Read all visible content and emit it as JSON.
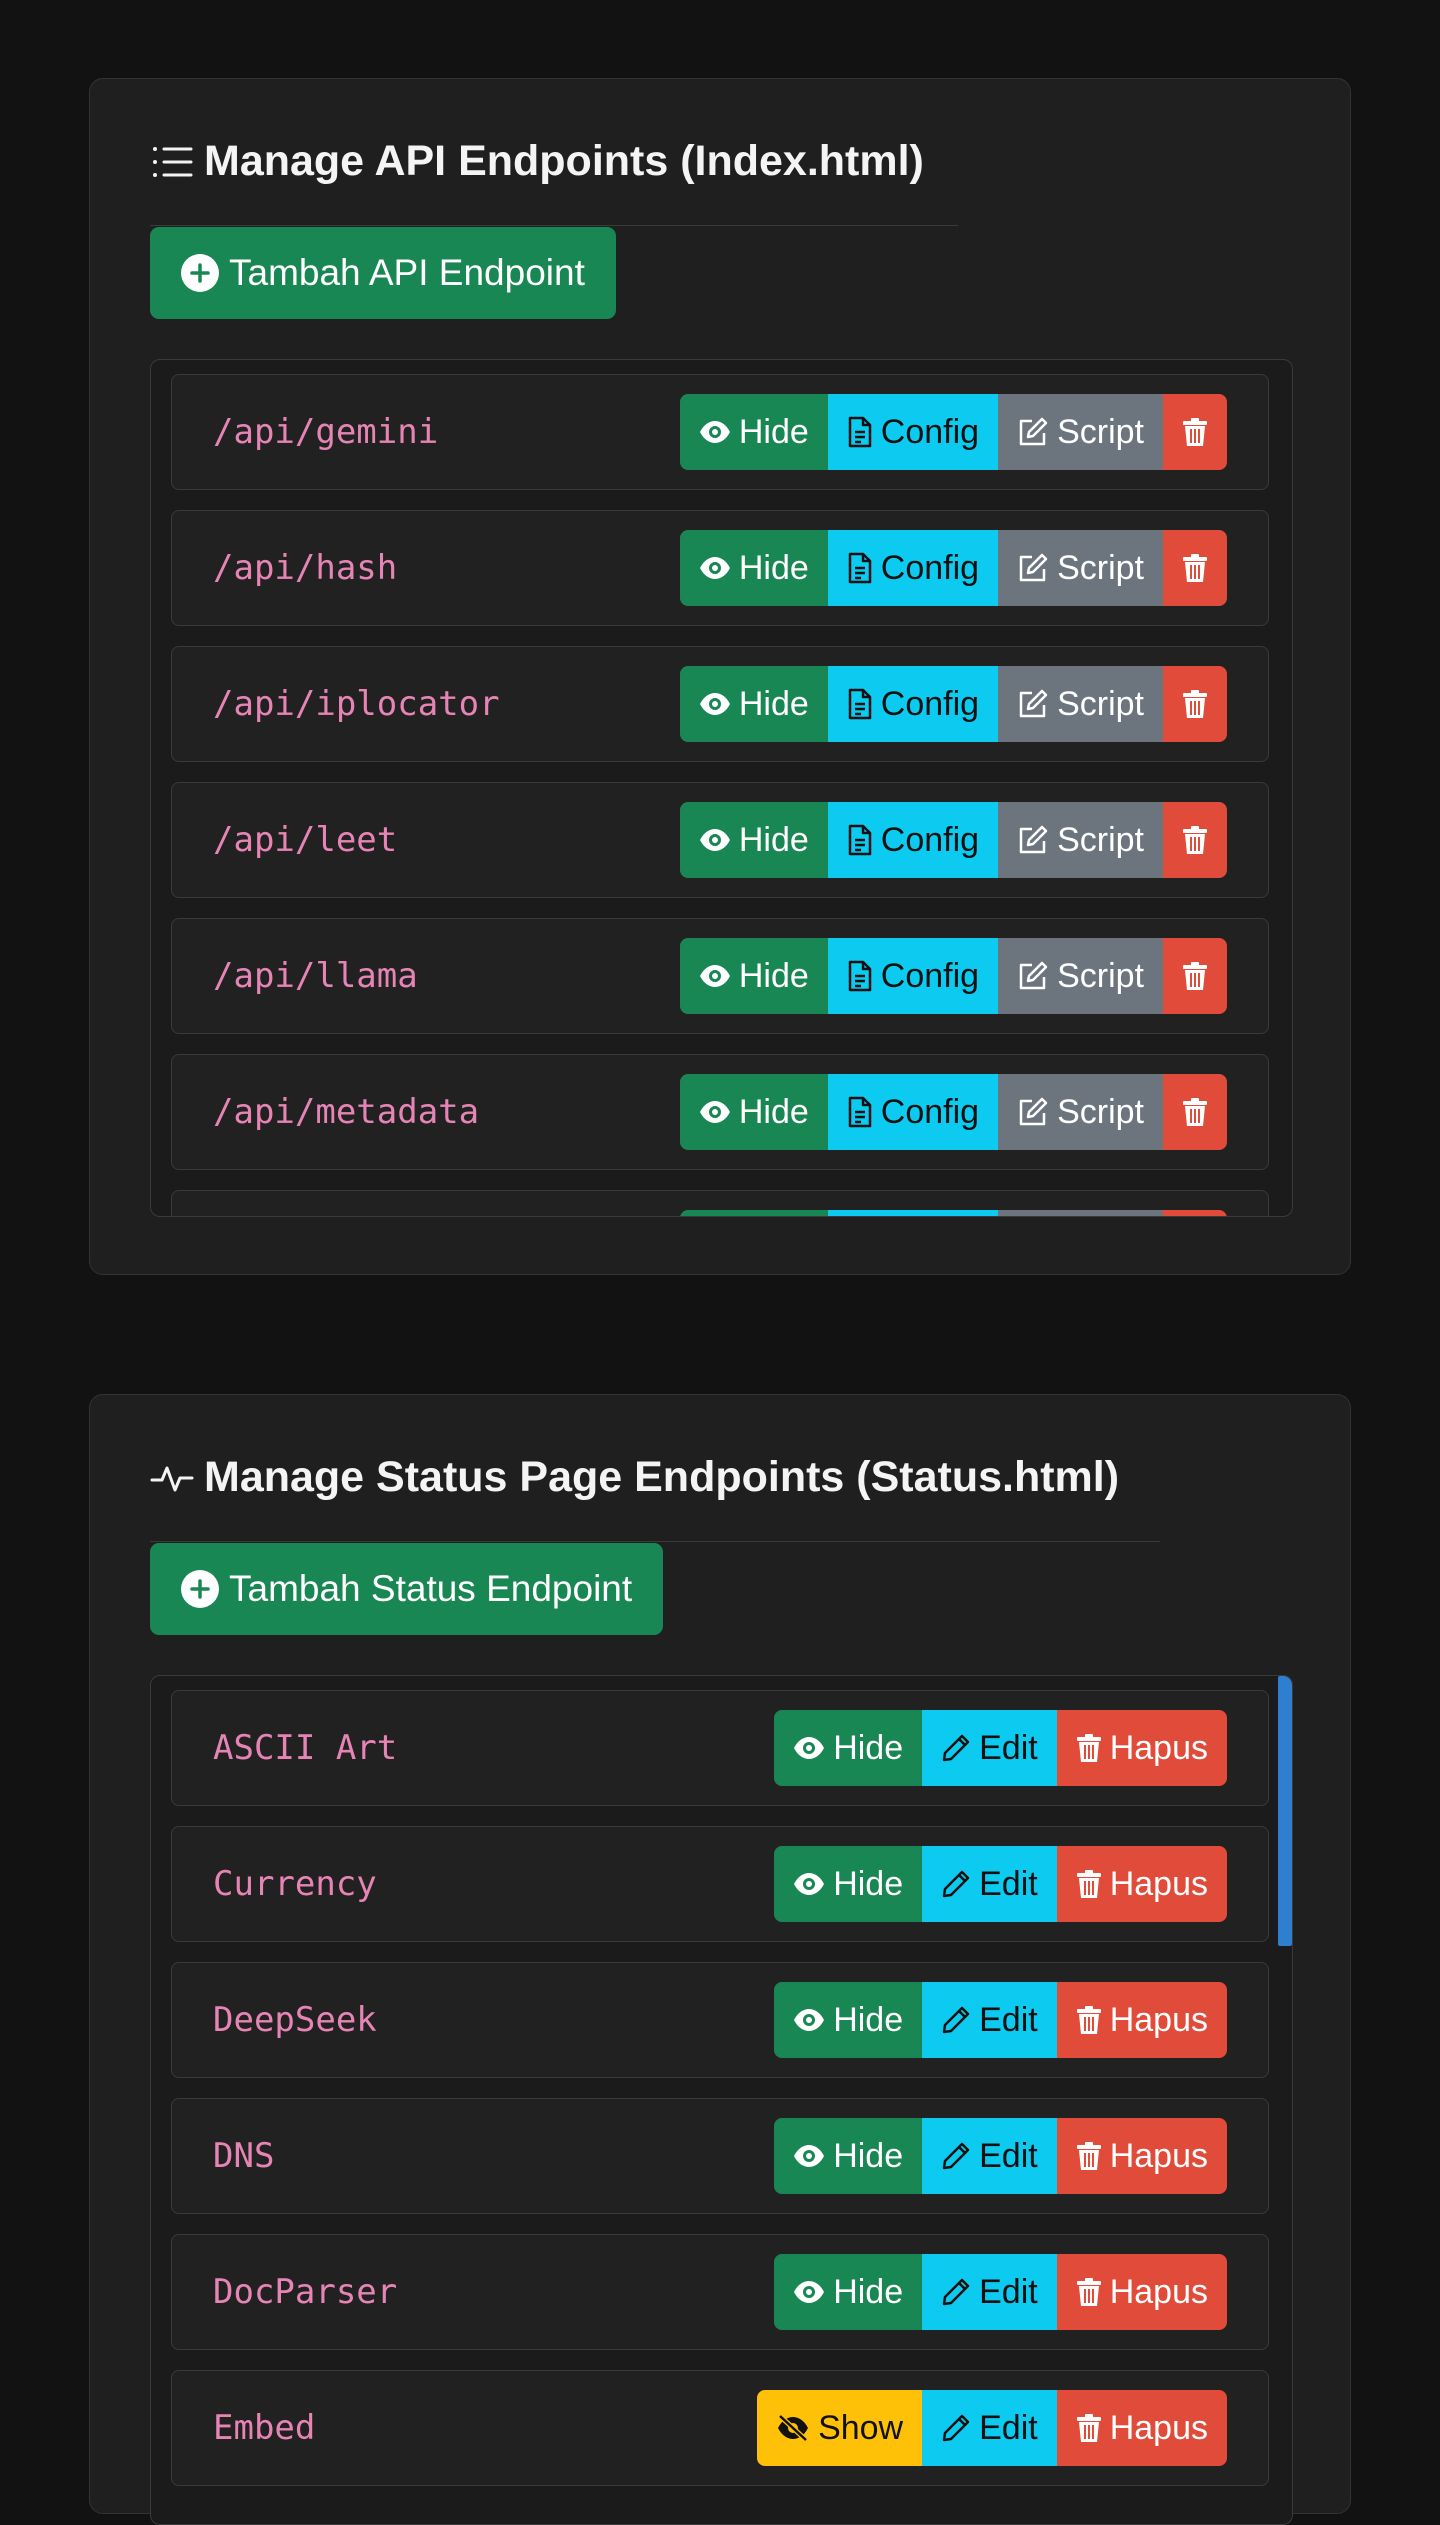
{
  "api_section": {
    "title": "Manage API Endpoints (Index.html)",
    "add_label": "Tambah API Endpoint",
    "buttons": {
      "hide": "Hide",
      "config": "Config",
      "script": "Script"
    },
    "endpoints": [
      {
        "path": "/api/gemini"
      },
      {
        "path": "/api/hash"
      },
      {
        "path": "/api/iplocator"
      },
      {
        "path": "/api/leet"
      },
      {
        "path": "/api/llama"
      },
      {
        "path": "/api/metadata"
      },
      {
        "path": ""
      }
    ]
  },
  "status_section": {
    "title": "Manage Status Page Endpoints (Status.html)",
    "add_label": "Tambah Status Endpoint",
    "buttons": {
      "hide": "Hide",
      "show": "Show",
      "edit": "Edit",
      "delete": "Hapus"
    },
    "endpoints": [
      {
        "name": "ASCII Art",
        "visible": true
      },
      {
        "name": "Currency",
        "visible": true
      },
      {
        "name": "DeepSeek",
        "visible": true
      },
      {
        "name": "DNS",
        "visible": true
      },
      {
        "name": "DocParser",
        "visible": true
      },
      {
        "name": "Embed",
        "visible": false
      }
    ]
  },
  "colors": {
    "success": "#198754",
    "info": "#0dcaf0",
    "secondary": "#6c757d",
    "danger": "#e04b3a",
    "warning": "#ffc107",
    "path_text": "#e685b5",
    "scrollbar": "#2f7fd0"
  }
}
